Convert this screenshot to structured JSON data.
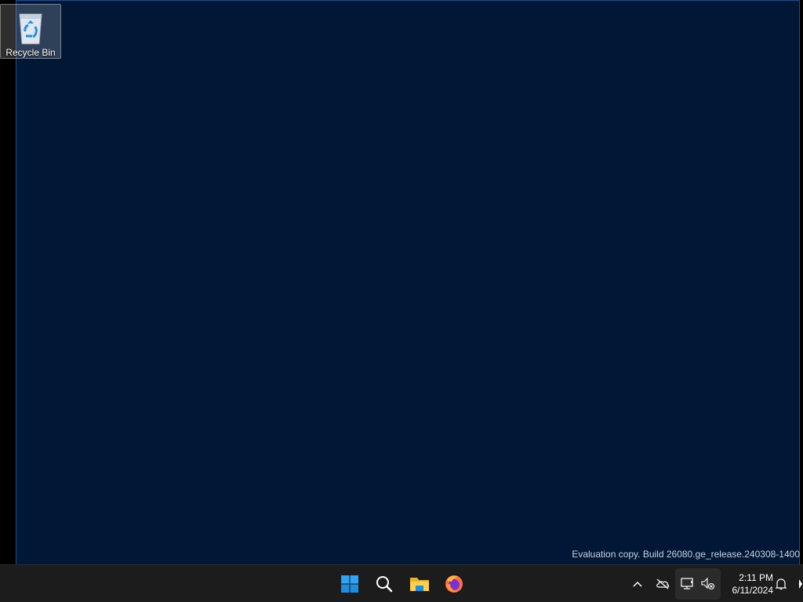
{
  "desktop": {
    "icons": [
      {
        "label": "Recycle Bin",
        "icon": "recycle-bin-icon"
      }
    ],
    "watermark": "Evaluation copy. Build 26080.ge_release.240308-1400"
  },
  "taskbar": {
    "pinned": [
      {
        "name": "start",
        "icon": "windows-logo-icon"
      },
      {
        "name": "search",
        "icon": "search-icon"
      },
      {
        "name": "file-explorer",
        "icon": "folder-icon"
      },
      {
        "name": "firefox",
        "icon": "firefox-icon"
      }
    ],
    "tray": {
      "overflow_icon": "chevron-up-icon",
      "onedrive_icon": "cloud-offline-icon",
      "network_icon": "network-icon",
      "volume_icon": "speaker-muted-icon",
      "notification_icon": "bell-icon"
    },
    "clock": {
      "time": "2:11 PM",
      "date": "6/11/2024"
    }
  },
  "colors": {
    "wallpaper": "#001835",
    "taskbar": "#1c1c1c",
    "accent": "#0078d4"
  }
}
